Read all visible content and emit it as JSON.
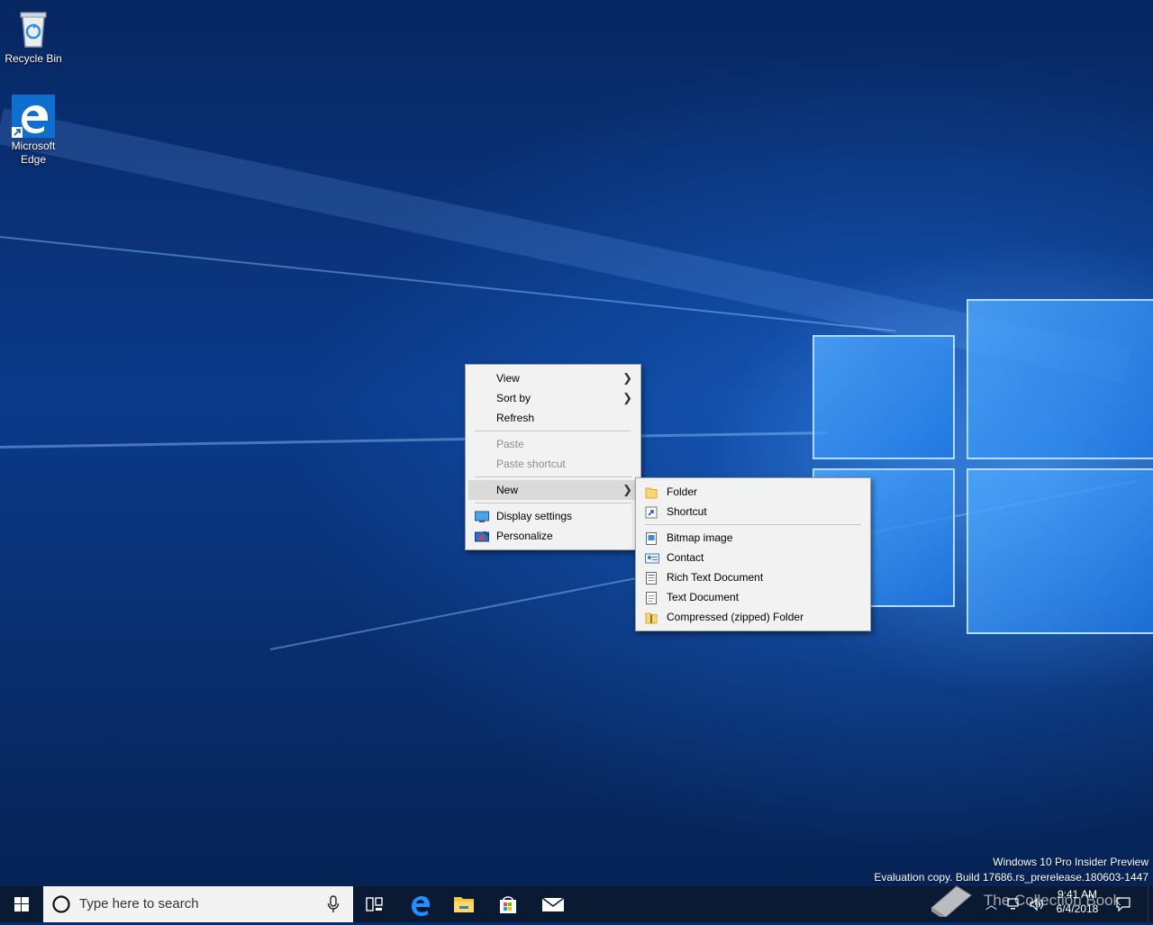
{
  "desktop": {
    "icons": [
      {
        "label": "Recycle Bin",
        "icon": "recycle-bin-icon"
      },
      {
        "label_line1": "Microsoft",
        "label_line2": "Edge",
        "icon": "edge-icon"
      }
    ],
    "watermark": {
      "line1": "Windows 10 Pro Insider Preview",
      "line2": "Evaluation copy. Build 17686.rs_prerelease.180603-1447"
    }
  },
  "context_menu": {
    "items": [
      {
        "label": "View",
        "submenu": true
      },
      {
        "label": "Sort by",
        "submenu": true
      },
      {
        "label": "Refresh"
      },
      {
        "label": "Paste",
        "disabled": true
      },
      {
        "label": "Paste shortcut",
        "disabled": true
      },
      {
        "label": "New",
        "submenu": true,
        "active": true
      },
      {
        "label": "Display settings",
        "icon": "display-settings-icon"
      },
      {
        "label": "Personalize",
        "icon": "personalize-icon"
      }
    ],
    "arrow_glyph": "❯"
  },
  "new_submenu": {
    "items": [
      {
        "label": "Folder",
        "icon": "folder-icon"
      },
      {
        "label": "Shortcut",
        "icon": "shortcut-icon"
      },
      {
        "label": "Bitmap image",
        "icon": "bitmap-image-icon"
      },
      {
        "label": "Contact",
        "icon": "contact-icon"
      },
      {
        "label": "Rich Text Document",
        "icon": "rich-text-document-icon"
      },
      {
        "label": "Text Document",
        "icon": "text-document-icon"
      },
      {
        "label": "Compressed (zipped) Folder",
        "icon": "zip-folder-icon"
      }
    ]
  },
  "taskbar": {
    "search_placeholder": "Type here to search",
    "clock_time": "9:41 AM",
    "clock_date": "6/4/2018",
    "overlay_text": "The Collection Book"
  },
  "colors": {
    "accent": "#0078d7",
    "taskbar": "#0a1a33",
    "menu_bg": "#f2f2f2"
  }
}
